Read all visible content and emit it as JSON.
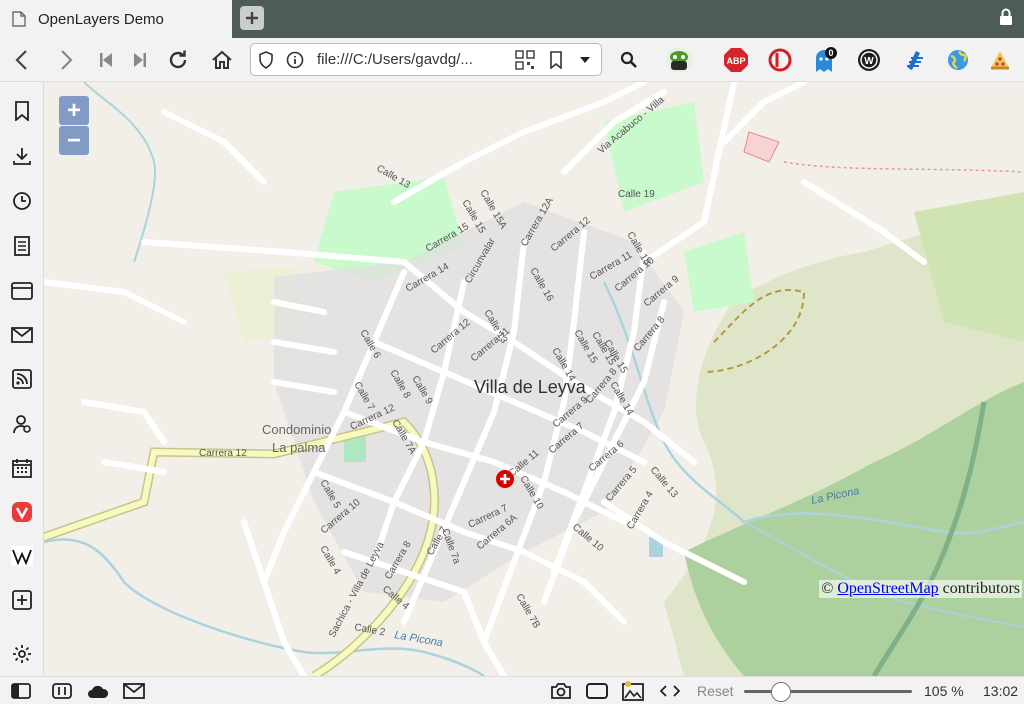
{
  "tab": {
    "title": "OpenLayers Demo"
  },
  "address_bar": {
    "url": "file:///C:/Users/gavdg/..."
  },
  "extensions": [
    {
      "name": "martian-extension-icon"
    },
    {
      "name": "adblock-plus-icon",
      "label": "ABP"
    },
    {
      "name": "red-circle-extension-icon"
    },
    {
      "name": "ghostery-icon",
      "badge": "0"
    },
    {
      "name": "w-circle-extension-icon",
      "label": "W"
    },
    {
      "name": "blue-bars-extension-icon"
    },
    {
      "name": "globe-extension-icon"
    },
    {
      "name": "pizza-extension-icon"
    }
  ],
  "sidebar": {
    "items": [
      "bookmarks-icon",
      "downloads-icon",
      "history-icon",
      "notes-icon",
      "window-icon",
      "mail-icon",
      "feeds-icon",
      "contacts-icon",
      "calendar-icon",
      "vivaldi-icon",
      "wikipedia-icon",
      "add-panel-icon",
      "settings-icon"
    ]
  },
  "map": {
    "zoom_in": "+",
    "zoom_out": "−",
    "place_labels": {
      "town": "Villa de Leyva",
      "condo1": "Condominio",
      "condo2": "La palma",
      "river1": "La Picona",
      "river2": "La Picona"
    },
    "street_labels": [
      {
        "t": "Calle 13"
      },
      {
        "t": "Calle 15A"
      },
      {
        "t": "Calle 15"
      },
      {
        "t": "Carrera 15"
      },
      {
        "t": "Carrera 12A"
      },
      {
        "t": "Carrera 12"
      },
      {
        "t": "Calle 19"
      },
      {
        "t": "Via Acabuco - Villa"
      },
      {
        "t": "Carrera 14"
      },
      {
        "t": "Circunvalar"
      },
      {
        "t": "Calle 16"
      },
      {
        "t": "Calle 18"
      },
      {
        "t": "Carrera 11"
      },
      {
        "t": "Carrera 10"
      },
      {
        "t": "Carrera 9"
      },
      {
        "t": "Calle 13"
      },
      {
        "t": "Calle 15"
      },
      {
        "t": "Calle 15"
      },
      {
        "t": "Carrera 12"
      },
      {
        "t": "Carrera 11"
      },
      {
        "t": "Calle 14"
      },
      {
        "t": "Calle 15"
      },
      {
        "t": "Carrera 8"
      },
      {
        "t": "Calle 6"
      },
      {
        "t": "Calle 8"
      },
      {
        "t": "Calle 9"
      },
      {
        "t": "Calle 7"
      },
      {
        "t": "Carrera 9"
      },
      {
        "t": "Carrera 8"
      },
      {
        "t": "Calle 14"
      },
      {
        "t": "Carrera 12"
      },
      {
        "t": "Carrera 12"
      },
      {
        "t": "Calle 7A"
      },
      {
        "t": "Carrera 7"
      },
      {
        "t": "Calle 11"
      },
      {
        "t": "Carrera 6"
      },
      {
        "t": "Carrera 5"
      },
      {
        "t": "Calle 10"
      },
      {
        "t": "Carrera 4"
      },
      {
        "t": "Calle 13"
      },
      {
        "t": "Calle 5"
      },
      {
        "t": "Carrera 10"
      },
      {
        "t": "Carrera 7"
      },
      {
        "t": "Carrera 6A"
      },
      {
        "t": "Calle 7a"
      },
      {
        "t": "Calle 7"
      },
      {
        "t": "Carrera 8"
      },
      {
        "t": "Calle 10"
      },
      {
        "t": "Calle 4"
      },
      {
        "t": "Calle 4"
      },
      {
        "t": "Calle 7B"
      },
      {
        "t": "Calle 2"
      },
      {
        "t": "Sachica - Villa de Leyva"
      }
    ],
    "attribution_prefix": "© ",
    "attribution_link": "OpenStreetMap",
    "attribution_suffix": " contributors"
  },
  "statusbar": {
    "reset_label": "Reset",
    "zoom_percent": 105,
    "zoom_label": "105 %",
    "time": "13:02"
  },
  "colors": {
    "water": "#aad3df",
    "park": "#c8facc",
    "forest": "#add19e",
    "road": "#ffffff",
    "primary_road": "#f7fabf",
    "hospital": "#da0000"
  }
}
